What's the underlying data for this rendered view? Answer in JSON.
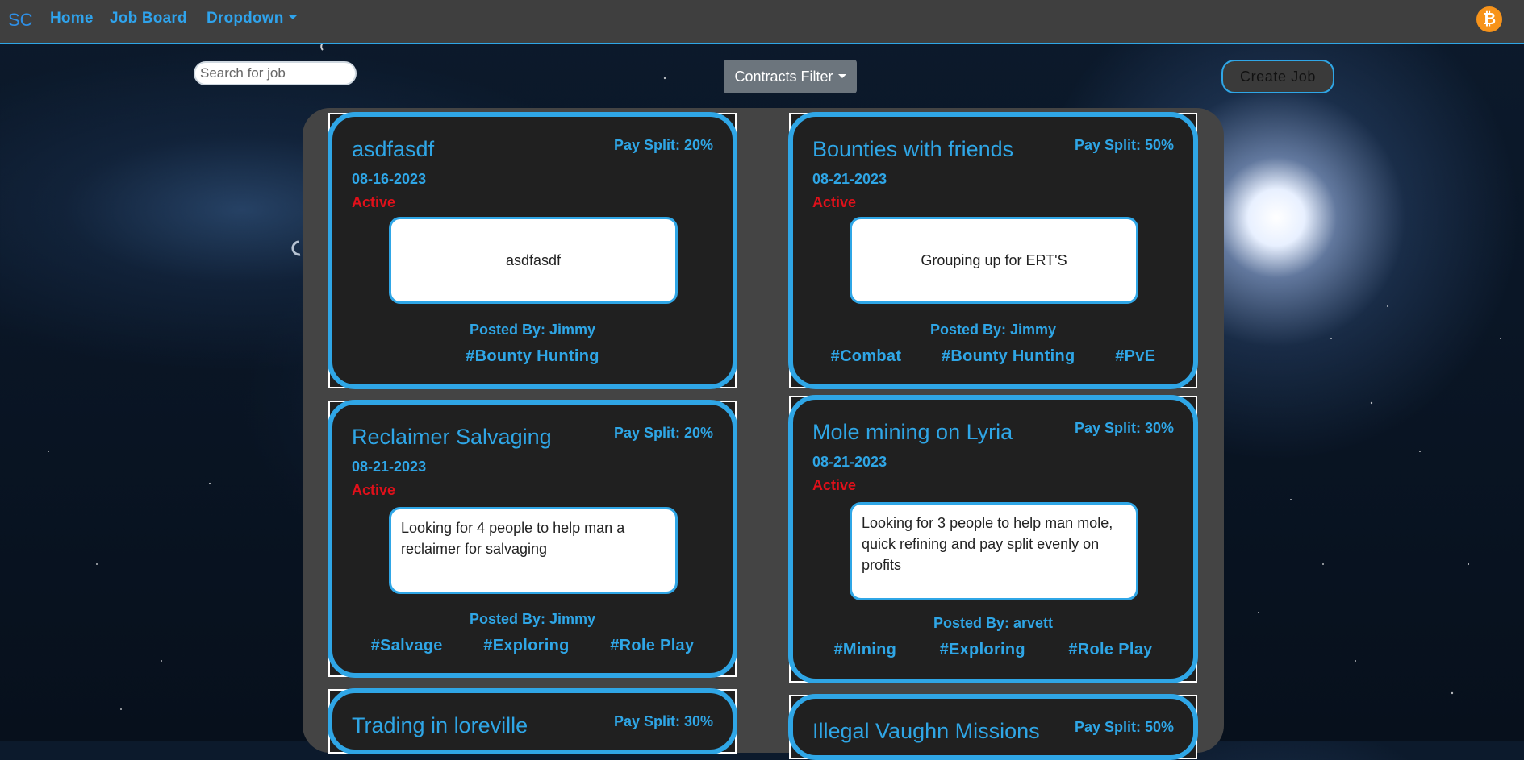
{
  "nav": {
    "brand": "SC",
    "links": [
      "Home",
      "Job Board",
      "Dropdown"
    ],
    "currency_icon": "bitcoin-icon"
  },
  "toolbar": {
    "search_placeholder": "Search for job",
    "filter_label": "Contracts Filter",
    "create_label": "Create Job"
  },
  "colors": {
    "accent": "#2fa6e6",
    "active": "#e0101a",
    "card_bg": "#202020",
    "board_bg": "#444444",
    "navbar_bg": "#3f3f3f"
  },
  "jobs": [
    {
      "title": "asdfasdf",
      "pay": "Pay Split: 20%",
      "date": "08-16-2023",
      "status": "Active",
      "description": "asdfasdf",
      "posted_by": "Posted By: Jimmy",
      "tags": [
        "#Bounty Hunting"
      ]
    },
    {
      "title": "Bounties with friends",
      "pay": "Pay Split: 50%",
      "date": "08-21-2023",
      "status": "Active",
      "description": "Grouping up for ERT'S",
      "posted_by": "Posted By: Jimmy",
      "tags": [
        "#Combat",
        "#Bounty Hunting",
        "#PvE"
      ]
    },
    {
      "title": "Reclaimer Salvaging",
      "pay": "Pay Split: 20%",
      "date": "08-21-2023",
      "status": "Active",
      "description": "Looking for 4 people to help man a reclaimer for salvaging",
      "posted_by": "Posted By: Jimmy",
      "tags": [
        "#Salvage",
        "#Exploring",
        "#Role Play"
      ]
    },
    {
      "title": "Mole mining on Lyria",
      "pay": "Pay Split: 30%",
      "date": "08-21-2023",
      "status": "Active",
      "description": "Looking for 3 people to help man mole, quick refining and pay split evenly on profits",
      "posted_by": "Posted By: arvett",
      "tags": [
        "#Mining",
        "#Exploring",
        "#Role Play"
      ]
    },
    {
      "title": "Trading in loreville",
      "pay": "Pay Split: 30%"
    },
    {
      "title": "Illegal Vaughn Missions",
      "pay": "Pay Split: 50%"
    }
  ]
}
